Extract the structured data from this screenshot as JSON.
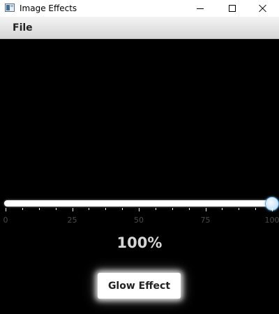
{
  "window": {
    "title": "Image Effects",
    "icon": "app-window-icon",
    "controls": [
      "minimize-icon",
      "maximize-icon",
      "close-icon"
    ]
  },
  "menu": {
    "items": [
      {
        "label": "File"
      }
    ]
  },
  "slider": {
    "value_percent": 100,
    "min": 0,
    "max": 100,
    "tick_labels": [
      "0",
      "25",
      "50",
      "75",
      "100"
    ],
    "thumb_color": "#cfe6fa",
    "track_color": "#ffffff"
  },
  "readout": {
    "text": "100%"
  },
  "button": {
    "label": "Glow Effect"
  },
  "colors": {
    "background": "#000000",
    "menubar": "#e0e0e0",
    "percent_text": "#d6d6d6"
  }
}
